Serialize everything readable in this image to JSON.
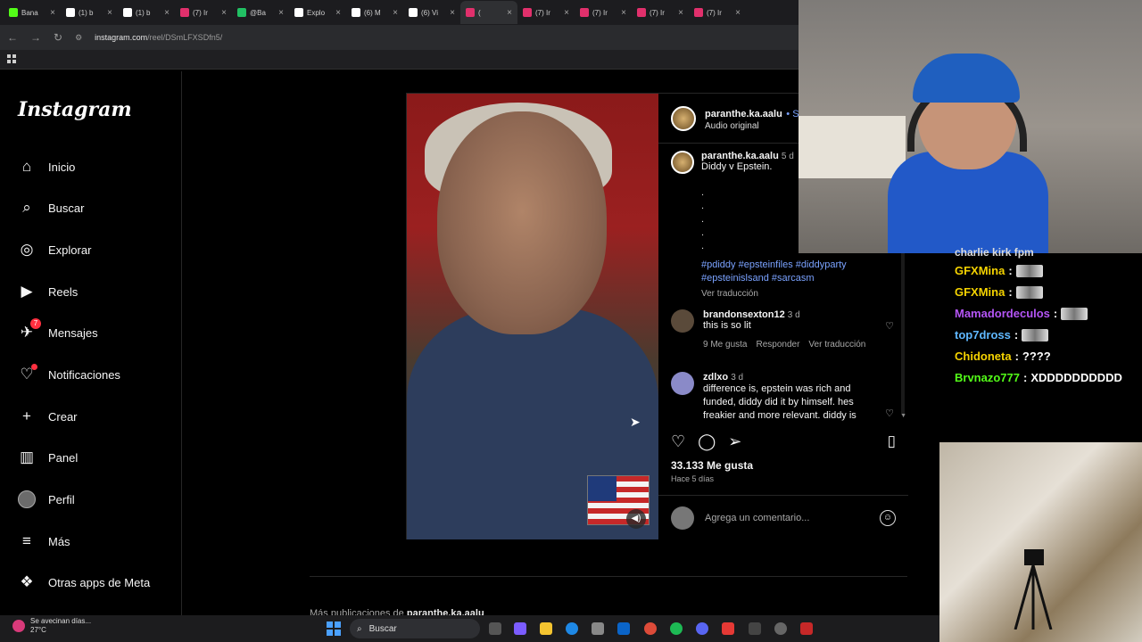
{
  "browser": {
    "tabs": [
      {
        "label": "Bana",
        "icon": "kick-icon",
        "color": "#53fc18"
      },
      {
        "label": "(1) b",
        "icon": "x-icon",
        "color": "#ffffff"
      },
      {
        "label": "(1) b",
        "icon": "x-icon",
        "color": "#ffffff"
      },
      {
        "label": "(7) Ir",
        "icon": "instagram-icon",
        "color": "#e1306c"
      },
      {
        "label": "@Ba",
        "icon": "chat-icon",
        "color": "#21c063"
      },
      {
        "label": "Explo",
        "icon": "tiktok-icon",
        "color": "#ffffff"
      },
      {
        "label": "(6) M",
        "icon": "x-icon",
        "color": "#ffffff"
      },
      {
        "label": "(6) Vi",
        "icon": "x-icon",
        "color": "#ffffff"
      },
      {
        "label": "(",
        "icon": "instagram-icon",
        "color": "#e1306c",
        "active": true
      },
      {
        "label": "(7) Ir",
        "icon": "instagram-icon",
        "color": "#e1306c"
      },
      {
        "label": "(7) Ir",
        "icon": "instagram-icon",
        "color": "#e1306c"
      },
      {
        "label": "(7) Ir",
        "icon": "instagram-icon",
        "color": "#e1306c"
      },
      {
        "label": "(7) Ir",
        "icon": "instagram-icon",
        "color": "#e1306c"
      }
    ],
    "url_host": "instagram.com",
    "url_path": "/reel/DSmLFXSDfn5/"
  },
  "sidebar": {
    "logo": "Instagram",
    "items": [
      {
        "label": "Inicio",
        "icon": "home-icon"
      },
      {
        "label": "Buscar",
        "icon": "search-icon"
      },
      {
        "label": "Explorar",
        "icon": "compass-icon"
      },
      {
        "label": "Reels",
        "icon": "reels-icon"
      },
      {
        "label": "Mensajes",
        "icon": "messages-icon",
        "badge": "7"
      },
      {
        "label": "Notificaciones",
        "icon": "heart-icon"
      },
      {
        "label": "Crear",
        "icon": "plus-icon"
      },
      {
        "label": "Panel",
        "icon": "chart-icon"
      },
      {
        "label": "Perfil",
        "icon": "avatar"
      },
      {
        "label": "Más",
        "icon": "menu-icon"
      },
      {
        "label": "Otras apps de Meta",
        "icon": "apps-icon"
      }
    ]
  },
  "post": {
    "author": "paranthe.ka.aalu",
    "follow_sep": "• Se",
    "audio": "Audio original",
    "caption_user": "paranthe.ka.aalu",
    "caption_time": "5 d",
    "caption_text": "Diddy v Epstein.",
    "caption_dots": [
      ".",
      ".",
      ".",
      ".",
      "."
    ],
    "hashtags_1": "#pdiddy #epsteinfiles #diddyparty",
    "hashtags_2": "#epsteinislsand #sarcasm",
    "see_translation": "Ver traducción",
    "comments": [
      {
        "user": "brandonsexton12",
        "time": "3 d",
        "text": "this is so lit",
        "likes": "9 Me gusta",
        "reply": "Responder",
        "translate": "Ver traducción"
      },
      {
        "user": "zdlxo",
        "time": "3 d",
        "text": "difference is, epstein was rich and funded, diddy did it by himself. hes freakier and more relevant. diddy is"
      }
    ],
    "likes": "33.133 Me gusta",
    "ago": "Hace 5 días",
    "add_comment_placeholder": "Agrega un comentario...",
    "more_posts_prefix": "Más publicaciones de",
    "more_posts_user": "paranthe.ka.aalu"
  },
  "chat": {
    "partial_top": "charlie kirk fpm",
    "messages": [
      {
        "user": "GFXMina",
        "text": "",
        "color": "#f5d300",
        "emote": true
      },
      {
        "user": "GFXMina",
        "text": "",
        "color": "#f5d300",
        "emote": true
      },
      {
        "user": "Mamadordeculos",
        "text": "",
        "color": "#b455f5",
        "emote": true
      },
      {
        "user": "top7dross",
        "text": "",
        "color": "#5fb8ff",
        "emote": true
      },
      {
        "user": "Chidoneta",
        "text": "????",
        "color": "#f5d300",
        "emote": false
      },
      {
        "user": "Brvnazo777",
        "text": "XDDDDDDDDDD",
        "color": "#53fc18",
        "emote": false
      }
    ]
  },
  "taskbar": {
    "weather_line1": "Se avecinan días...",
    "weather_line2": "27°C",
    "search_label": "Buscar"
  }
}
